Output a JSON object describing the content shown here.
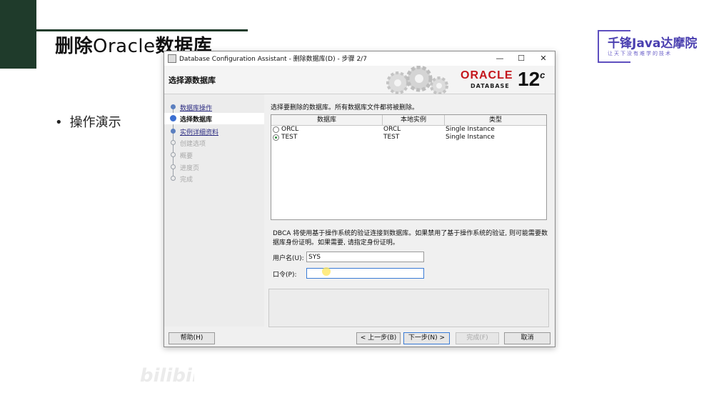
{
  "slide": {
    "title_prefix": "删除",
    "title_latin": "Oracle",
    "title_suffix": "数据库",
    "bullet": "操作演示",
    "logo_text": "千锋Java达摩院",
    "logo_sub": "让天下没有难学的技术",
    "watermark_text": "",
    "watermark_logo": "bilibili"
  },
  "window": {
    "title": "Database Configuration Assistant - 删除数据库(D) - 步骤 2/7",
    "minimize_label": "—",
    "maximize_label": "☐",
    "close_label": "✕"
  },
  "header": {
    "step_title": "选择源数据库",
    "oracle_word": "ORACLE",
    "oracle_db": "DATABASE",
    "version": "12",
    "version_sup": "c"
  },
  "nav": {
    "items": [
      {
        "label": "数据库操作",
        "state": "link"
      },
      {
        "label": "选择数据库",
        "state": "active"
      },
      {
        "label": "实例详细资料",
        "state": "link"
      },
      {
        "label": "创建选项",
        "state": "disabled"
      },
      {
        "label": "概要",
        "state": "disabled"
      },
      {
        "label": "进度页",
        "state": "disabled"
      },
      {
        "label": "完成",
        "state": "disabled"
      }
    ]
  },
  "main": {
    "instruction": "选择要删除的数据库。所有数据库文件都将被删除。",
    "table": {
      "columns": [
        "数据库",
        "本地实例",
        "类型"
      ],
      "rows": [
        {
          "selected": false,
          "database": "ORCL",
          "instance": "ORCL",
          "type": "Single Instance"
        },
        {
          "selected": true,
          "database": "TEST",
          "instance": "TEST",
          "type": "Single Instance"
        }
      ]
    },
    "note": "DBCA 将使用基于操作系统的验证连接到数据库。如果禁用了基于操作系统的验证, 则可能需要数据库身份证明。如果需要, 请指定身份证明。",
    "username_label": "用户名(U):",
    "username_value": "SYS",
    "password_label": "口令(P):",
    "password_value": ""
  },
  "buttons": {
    "help": "帮助(H)",
    "back": "< 上一步(B)",
    "next": "下一步(N) >",
    "finish": "完成(F)",
    "cancel": "取消"
  }
}
